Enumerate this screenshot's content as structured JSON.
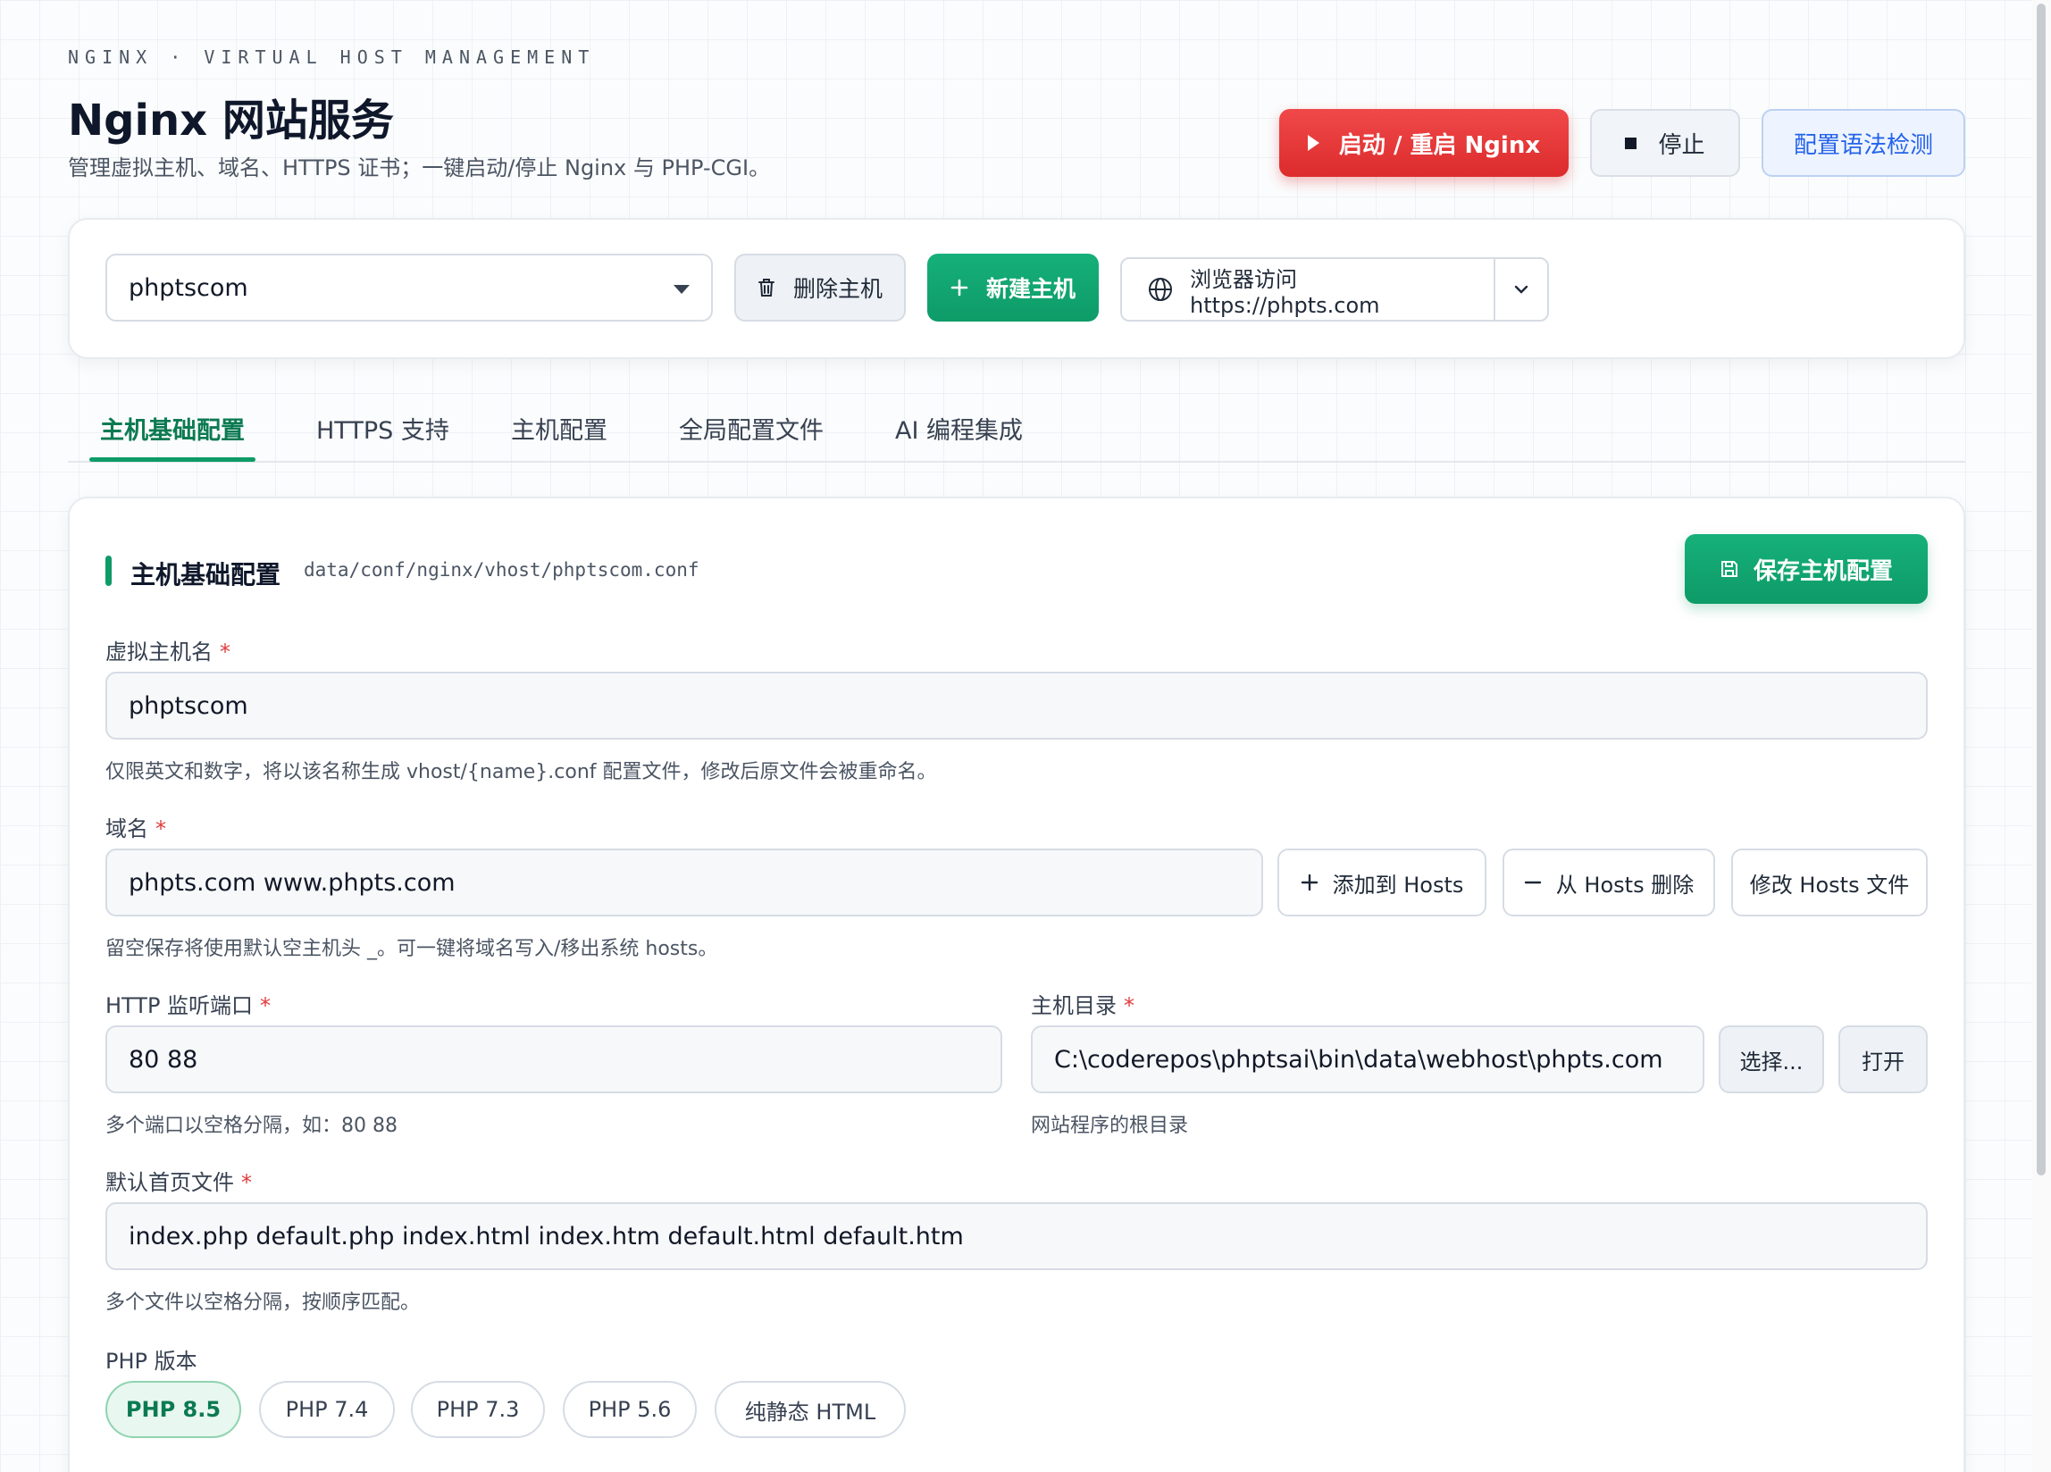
{
  "header": {
    "eyebrow": "NGINX · VIRTUAL HOST MANAGEMENT",
    "title": "Nginx 网站服务",
    "subtitle": "管理虚拟主机、域名、HTTPS 证书；一键启动/停止 Nginx 与 PHP-CGI。",
    "start_label": "启动 / 重启 Nginx",
    "stop_label": "停止",
    "check_label": "配置语法检测"
  },
  "toolbar": {
    "selected_host": "phptscom",
    "delete_label": "删除主机",
    "new_label": "新建主机",
    "browse_label": "浏览器访问 https://phpts.com"
  },
  "tabs": [
    {
      "label": "主机基础配置",
      "active": true
    },
    {
      "label": "HTTPS 支持",
      "active": false
    },
    {
      "label": "主机配置",
      "active": false
    },
    {
      "label": "全局配置文件",
      "active": false
    },
    {
      "label": "AI 编程集成",
      "active": false
    }
  ],
  "section": {
    "title": "主机基础配置",
    "path": "data/conf/nginx/vhost/phptscom.conf",
    "save_label": "保存主机配置"
  },
  "form": {
    "host_name": {
      "label": "虚拟主机名",
      "required": "*",
      "value": "phptscom",
      "hint": "仅限英文和数字，将以该名称生成 vhost/{name}.conf 配置文件，修改后原文件会被重命名。"
    },
    "domain": {
      "label": "域名",
      "required": "*",
      "value": "phpts.com www.phpts.com",
      "hint": "留空保存将使用默认空主机头 _。可一键将域名写入/移出系统 hosts。",
      "add_hosts_label": "添加到 Hosts",
      "remove_hosts_label": "从 Hosts 删除",
      "edit_hosts_label": "修改 Hosts 文件"
    },
    "http_port": {
      "label": "HTTP 监听端口",
      "required": "*",
      "value": "80 88",
      "hint": "多个端口以空格分隔，如：80 88"
    },
    "root_dir": {
      "label": "主机目录",
      "required": "*",
      "value": "C:\\coderepos\\phptsai\\bin\\data\\webhost\\phpts.com",
      "hint": "网站程序的根目录",
      "choose_label": "选择...",
      "open_label": "打开"
    },
    "index_files": {
      "label": "默认首页文件",
      "required": "*",
      "value": "index.php default.php index.html index.htm default.html default.htm",
      "hint": "多个文件以空格分隔，按顺序匹配。"
    },
    "php_version": {
      "label": "PHP 版本",
      "options": [
        "PHP 8.5",
        "PHP 7.4",
        "PHP 7.3",
        "PHP 5.6",
        "纯静态 HTML"
      ],
      "selected": "PHP 8.5"
    }
  },
  "colors": {
    "accent_green": "#0e9b68",
    "danger_red": "#dc2b2c",
    "link_blue": "#2563eb"
  }
}
